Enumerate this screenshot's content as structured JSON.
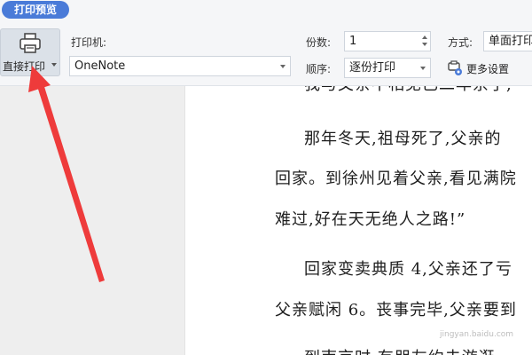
{
  "window": {
    "title_tab": "打印预览"
  },
  "toolbar": {
    "direct_print_label": "直接打印",
    "printer_label": "打印机:",
    "printer_value": "OneNote",
    "copies_label": "份数:",
    "copies_value": "1",
    "order_label": "顺序:",
    "order_value": "逐份打印",
    "mode_label": "方式:",
    "mode_value": "单面打印",
    "more_settings_label": "更多设置"
  },
  "document": {
    "lines": [
      "我与父亲不相见已二年余了,",
      "那年冬天,祖母死了,父亲的",
      "回家。到徐州见着父亲,看见满院",
      "难过,好在天无绝人之路!”",
      "回家变卖典质 4,父亲还了亏",
      "父亲赋闲 6。丧事完毕,父亲要到",
      "到南京时,有朋友约去游逛"
    ]
  },
  "watermark": "jingyan.baidu.com",
  "colors": {
    "accent": "#4a7bd8",
    "annotation_arrow": "#ee3b3b"
  },
  "icons": {
    "printer": "printer-icon",
    "settings": "settings-icon"
  }
}
